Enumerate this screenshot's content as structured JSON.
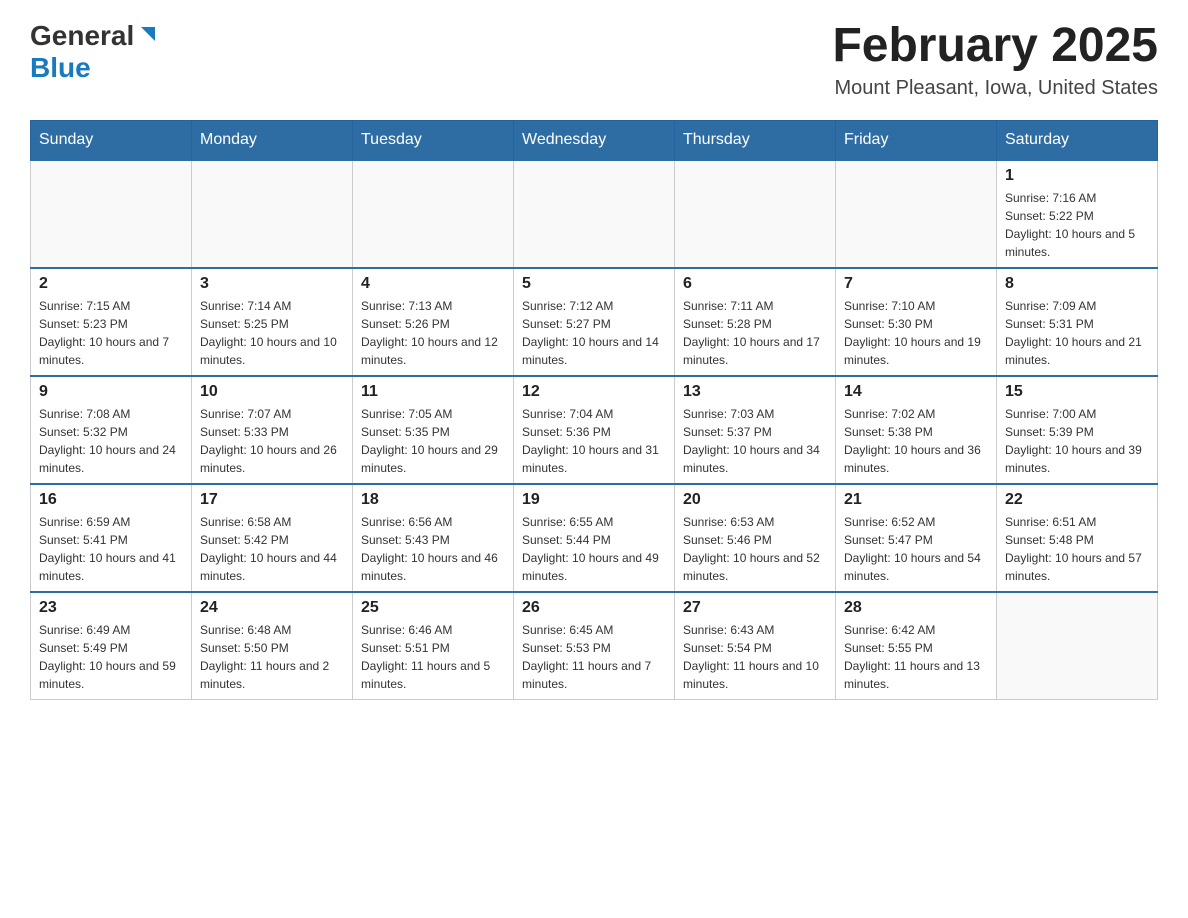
{
  "header": {
    "logo_general": "General",
    "logo_blue": "Blue",
    "month_title": "February 2025",
    "location": "Mount Pleasant, Iowa, United States"
  },
  "days_of_week": [
    "Sunday",
    "Monday",
    "Tuesday",
    "Wednesday",
    "Thursday",
    "Friday",
    "Saturday"
  ],
  "weeks": [
    {
      "days": [
        {
          "date": "",
          "info": ""
        },
        {
          "date": "",
          "info": ""
        },
        {
          "date": "",
          "info": ""
        },
        {
          "date": "",
          "info": ""
        },
        {
          "date": "",
          "info": ""
        },
        {
          "date": "",
          "info": ""
        },
        {
          "date": "1",
          "info": "Sunrise: 7:16 AM\nSunset: 5:22 PM\nDaylight: 10 hours and 5 minutes."
        }
      ]
    },
    {
      "days": [
        {
          "date": "2",
          "info": "Sunrise: 7:15 AM\nSunset: 5:23 PM\nDaylight: 10 hours and 7 minutes."
        },
        {
          "date": "3",
          "info": "Sunrise: 7:14 AM\nSunset: 5:25 PM\nDaylight: 10 hours and 10 minutes."
        },
        {
          "date": "4",
          "info": "Sunrise: 7:13 AM\nSunset: 5:26 PM\nDaylight: 10 hours and 12 minutes."
        },
        {
          "date": "5",
          "info": "Sunrise: 7:12 AM\nSunset: 5:27 PM\nDaylight: 10 hours and 14 minutes."
        },
        {
          "date": "6",
          "info": "Sunrise: 7:11 AM\nSunset: 5:28 PM\nDaylight: 10 hours and 17 minutes."
        },
        {
          "date": "7",
          "info": "Sunrise: 7:10 AM\nSunset: 5:30 PM\nDaylight: 10 hours and 19 minutes."
        },
        {
          "date": "8",
          "info": "Sunrise: 7:09 AM\nSunset: 5:31 PM\nDaylight: 10 hours and 21 minutes."
        }
      ]
    },
    {
      "days": [
        {
          "date": "9",
          "info": "Sunrise: 7:08 AM\nSunset: 5:32 PM\nDaylight: 10 hours and 24 minutes."
        },
        {
          "date": "10",
          "info": "Sunrise: 7:07 AM\nSunset: 5:33 PM\nDaylight: 10 hours and 26 minutes."
        },
        {
          "date": "11",
          "info": "Sunrise: 7:05 AM\nSunset: 5:35 PM\nDaylight: 10 hours and 29 minutes."
        },
        {
          "date": "12",
          "info": "Sunrise: 7:04 AM\nSunset: 5:36 PM\nDaylight: 10 hours and 31 minutes."
        },
        {
          "date": "13",
          "info": "Sunrise: 7:03 AM\nSunset: 5:37 PM\nDaylight: 10 hours and 34 minutes."
        },
        {
          "date": "14",
          "info": "Sunrise: 7:02 AM\nSunset: 5:38 PM\nDaylight: 10 hours and 36 minutes."
        },
        {
          "date": "15",
          "info": "Sunrise: 7:00 AM\nSunset: 5:39 PM\nDaylight: 10 hours and 39 minutes."
        }
      ]
    },
    {
      "days": [
        {
          "date": "16",
          "info": "Sunrise: 6:59 AM\nSunset: 5:41 PM\nDaylight: 10 hours and 41 minutes."
        },
        {
          "date": "17",
          "info": "Sunrise: 6:58 AM\nSunset: 5:42 PM\nDaylight: 10 hours and 44 minutes."
        },
        {
          "date": "18",
          "info": "Sunrise: 6:56 AM\nSunset: 5:43 PM\nDaylight: 10 hours and 46 minutes."
        },
        {
          "date": "19",
          "info": "Sunrise: 6:55 AM\nSunset: 5:44 PM\nDaylight: 10 hours and 49 minutes."
        },
        {
          "date": "20",
          "info": "Sunrise: 6:53 AM\nSunset: 5:46 PM\nDaylight: 10 hours and 52 minutes."
        },
        {
          "date": "21",
          "info": "Sunrise: 6:52 AM\nSunset: 5:47 PM\nDaylight: 10 hours and 54 minutes."
        },
        {
          "date": "22",
          "info": "Sunrise: 6:51 AM\nSunset: 5:48 PM\nDaylight: 10 hours and 57 minutes."
        }
      ]
    },
    {
      "days": [
        {
          "date": "23",
          "info": "Sunrise: 6:49 AM\nSunset: 5:49 PM\nDaylight: 10 hours and 59 minutes."
        },
        {
          "date": "24",
          "info": "Sunrise: 6:48 AM\nSunset: 5:50 PM\nDaylight: 11 hours and 2 minutes."
        },
        {
          "date": "25",
          "info": "Sunrise: 6:46 AM\nSunset: 5:51 PM\nDaylight: 11 hours and 5 minutes."
        },
        {
          "date": "26",
          "info": "Sunrise: 6:45 AM\nSunset: 5:53 PM\nDaylight: 11 hours and 7 minutes."
        },
        {
          "date": "27",
          "info": "Sunrise: 6:43 AM\nSunset: 5:54 PM\nDaylight: 11 hours and 10 minutes."
        },
        {
          "date": "28",
          "info": "Sunrise: 6:42 AM\nSunset: 5:55 PM\nDaylight: 11 hours and 13 minutes."
        },
        {
          "date": "",
          "info": ""
        }
      ]
    }
  ]
}
